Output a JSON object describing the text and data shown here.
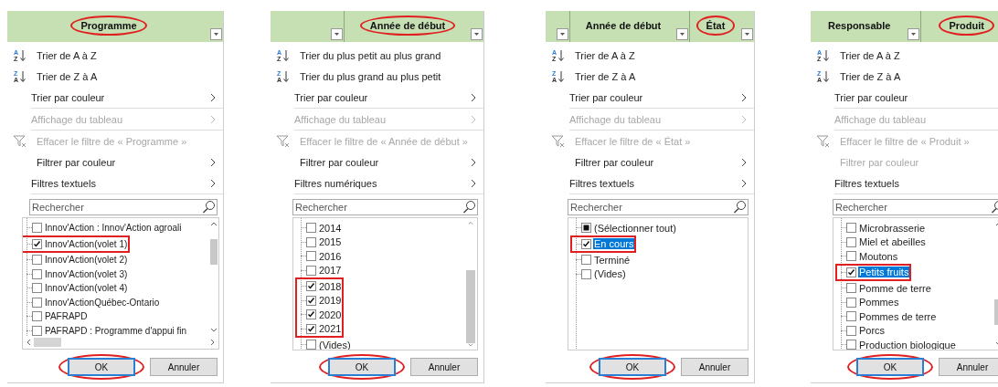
{
  "panels": [
    {
      "header_columns": [
        {
          "label": "Programme",
          "dropdown": true,
          "circled": true
        }
      ],
      "menu": [
        {
          "kind": "sort",
          "icon_top": "A",
          "icon_bottom": "Z",
          "label": "Trier de A à Z",
          "disabled": false,
          "submenu": false,
          "divider_below": false
        },
        {
          "kind": "sort",
          "icon_top": "Z",
          "icon_bottom": "A",
          "label": "Trier de Z à A",
          "disabled": false,
          "submenu": false,
          "divider_below": false
        },
        {
          "kind": "item",
          "label": "Trier par couleur",
          "disabled": false,
          "submenu": true,
          "divider_below": true
        },
        {
          "kind": "item",
          "label": "Affichage du tableau",
          "disabled": true,
          "submenu": true,
          "divider_below": true
        },
        {
          "kind": "clear",
          "label": "Effacer le filtre de « Programme »",
          "disabled": true,
          "submenu": false,
          "divider_below": false
        },
        {
          "kind": "item",
          "label": "Filtrer par couleur",
          "disabled": false,
          "submenu": true,
          "divider_below": false
        },
        {
          "kind": "item",
          "label": "Filtres textuels",
          "disabled": false,
          "submenu": true,
          "divider_below": true
        }
      ],
      "search": {
        "placeholder": "Rechercher"
      },
      "list": [
        {
          "label": "Innov'Action : Innov'Action agroali",
          "checked": false,
          "mixed": false,
          "selected": false,
          "boxed": false
        },
        {
          "label": "Innov'Action(volet 1)",
          "checked": true,
          "mixed": false,
          "selected": false,
          "boxed": true
        },
        {
          "label": "Innov'Action(volet 2)",
          "checked": false,
          "mixed": false,
          "selected": false,
          "boxed": false
        },
        {
          "label": "Innov'Action(volet 3)",
          "checked": false,
          "mixed": false,
          "selected": false,
          "boxed": false
        },
        {
          "label": "Innov'Action(volet 4)",
          "checked": false,
          "mixed": false,
          "selected": false,
          "boxed": false
        },
        {
          "label": "Innov'ActionQuébec-Ontario",
          "checked": false,
          "mixed": false,
          "selected": false,
          "boxed": false
        },
        {
          "label": "PAFRAPD",
          "checked": false,
          "mixed": false,
          "selected": false,
          "boxed": false
        },
        {
          "label": "PAFRAPD : Programme d'appui fin",
          "checked": false,
          "mixed": false,
          "selected": false,
          "boxed": false
        }
      ],
      "scrollbars": {
        "vertical": true,
        "horizontal": true
      },
      "buttons": [
        {
          "label": "OK",
          "kind": "default",
          "circled": true
        },
        {
          "label": "Annuler",
          "kind": "normal",
          "circled": false
        }
      ]
    },
    {
      "header_columns": [
        {
          "dropdown": true,
          "circled": false
        },
        {
          "label": "Année de début",
          "dropdown": true,
          "circled": true
        }
      ],
      "menu": [
        {
          "kind": "sort",
          "icon_top": "A",
          "icon_bottom": "Z",
          "label": "Trier du plus petit au plus grand",
          "disabled": false,
          "submenu": false,
          "divider_below": false
        },
        {
          "kind": "sort",
          "icon_top": "Z",
          "icon_bottom": "A",
          "label": "Trier du plus grand au plus petit",
          "disabled": false,
          "submenu": false,
          "divider_below": false
        },
        {
          "kind": "item",
          "label": "Trier par couleur",
          "disabled": false,
          "submenu": true,
          "divider_below": true
        },
        {
          "kind": "item",
          "label": "Affichage du tableau",
          "disabled": true,
          "submenu": true,
          "divider_below": true
        },
        {
          "kind": "clear",
          "label": "Effacer le filtre de « Année de début »",
          "disabled": true,
          "submenu": false,
          "divider_below": false
        },
        {
          "kind": "item",
          "label": "Filtrer par couleur",
          "disabled": false,
          "submenu": true,
          "divider_below": false
        },
        {
          "kind": "item",
          "label": "Filtres numériques",
          "disabled": false,
          "submenu": true,
          "divider_below": true
        }
      ],
      "search": {
        "placeholder": "Rechercher"
      },
      "list": [
        {
          "label": "2014",
          "checked": false,
          "mixed": false,
          "selected": false,
          "boxed": false
        },
        {
          "label": "2015",
          "checked": false,
          "mixed": false,
          "selected": false,
          "boxed": false
        },
        {
          "label": "2016",
          "checked": false,
          "mixed": false,
          "selected": false,
          "boxed": false
        },
        {
          "label": "2017",
          "checked": false,
          "mixed": false,
          "selected": false,
          "boxed": false
        },
        {
          "label": "2018",
          "checked": true,
          "mixed": false,
          "selected": false,
          "boxed": true
        },
        {
          "label": "2019",
          "checked": true,
          "mixed": false,
          "selected": false,
          "boxed": true
        },
        {
          "label": "2020",
          "checked": true,
          "mixed": false,
          "selected": false,
          "boxed": true
        },
        {
          "label": "2021",
          "checked": true,
          "mixed": false,
          "selected": false,
          "boxed": true
        },
        {
          "label": "(Vides)",
          "checked": false,
          "mixed": false,
          "selected": false,
          "boxed": false
        }
      ],
      "scrollbars": {
        "vertical": true,
        "horizontal": false
      },
      "buttons": [
        {
          "label": "OK",
          "kind": "default",
          "circled": true
        },
        {
          "label": "Annuler",
          "kind": "normal",
          "circled": false
        }
      ]
    },
    {
      "header_columns": [
        {
          "dropdown": true,
          "circled": false
        },
        {
          "label": "Année de début",
          "dropdown": true,
          "circled": false
        },
        {
          "label": "État",
          "dropdown": true,
          "circled": true
        }
      ],
      "menu": [
        {
          "kind": "sort",
          "icon_top": "A",
          "icon_bottom": "Z",
          "label": "Trier de A à Z",
          "disabled": false,
          "submenu": false,
          "divider_below": false
        },
        {
          "kind": "sort",
          "icon_top": "Z",
          "icon_bottom": "A",
          "label": "Trier de Z à A",
          "disabled": false,
          "submenu": false,
          "divider_below": false
        },
        {
          "kind": "item",
          "label": "Trier par couleur",
          "disabled": false,
          "submenu": true,
          "divider_below": true
        },
        {
          "kind": "item",
          "label": "Affichage du tableau",
          "disabled": true,
          "submenu": true,
          "divider_below": true
        },
        {
          "kind": "clear",
          "label": "Effacer le filtre de « État »",
          "disabled": true,
          "submenu": false,
          "divider_below": false
        },
        {
          "kind": "item",
          "label": "Filtrer par couleur",
          "disabled": false,
          "submenu": true,
          "divider_below": false
        },
        {
          "kind": "item",
          "label": "Filtres textuels",
          "disabled": false,
          "submenu": true,
          "divider_below": true
        }
      ],
      "search": {
        "placeholder": "Rechercher"
      },
      "list": [
        {
          "label": "(Sélectionner tout)",
          "checked": false,
          "mixed": true,
          "selected": false,
          "boxed": false
        },
        {
          "label": "En cours",
          "checked": true,
          "mixed": false,
          "selected": true,
          "boxed": true
        },
        {
          "label": "Terminé",
          "checked": false,
          "mixed": false,
          "selected": false,
          "boxed": false
        },
        {
          "label": "(Vides)",
          "checked": false,
          "mixed": false,
          "selected": false,
          "boxed": false
        }
      ],
      "scrollbars": {
        "vertical": false,
        "horizontal": false
      },
      "buttons": [
        {
          "label": "OK",
          "kind": "default",
          "circled": true
        },
        {
          "label": "Annuler",
          "kind": "normal",
          "circled": false
        }
      ]
    },
    {
      "header_columns": [
        {
          "label": "Responsable",
          "dropdown": true,
          "circled": false
        },
        {
          "label": "Produit",
          "dropdown": false,
          "circled": true
        }
      ],
      "menu": [
        {
          "kind": "sort",
          "icon_top": "A",
          "icon_bottom": "Z",
          "label": "Trier de A à Z",
          "disabled": false,
          "submenu": false,
          "divider_below": false
        },
        {
          "kind": "sort",
          "icon_top": "Z",
          "icon_bottom": "A",
          "label": "Trier de Z à A",
          "disabled": false,
          "submenu": false,
          "divider_below": false
        },
        {
          "kind": "item",
          "label": "Trier par couleur",
          "disabled": false,
          "submenu": false,
          "divider_below": true
        },
        {
          "kind": "item",
          "label": "Affichage du tableau",
          "disabled": true,
          "submenu": false,
          "divider_below": true
        },
        {
          "kind": "clear",
          "label": "Effacer le filtre de « Produit »",
          "disabled": true,
          "submenu": false,
          "divider_below": false
        },
        {
          "kind": "item",
          "label": "Filtrer par couleur",
          "disabled": true,
          "submenu": false,
          "divider_below": false
        },
        {
          "kind": "item",
          "label": "Filtres textuels",
          "disabled": false,
          "submenu": false,
          "divider_below": true
        }
      ],
      "search": {
        "placeholder": "Rechercher"
      },
      "list": [
        {
          "label": "Microbrasserie",
          "checked": false,
          "mixed": false,
          "selected": false,
          "boxed": false
        },
        {
          "label": "Miel et abeilles",
          "checked": false,
          "mixed": false,
          "selected": false,
          "boxed": false
        },
        {
          "label": "Moutons",
          "checked": false,
          "mixed": false,
          "selected": false,
          "boxed": false
        },
        {
          "label": "Petits fruits",
          "checked": true,
          "mixed": false,
          "selected": true,
          "boxed": true
        },
        {
          "label": "Pomme de terre",
          "checked": false,
          "mixed": false,
          "selected": false,
          "boxed": false
        },
        {
          "label": "Pommes",
          "checked": false,
          "mixed": false,
          "selected": false,
          "boxed": false
        },
        {
          "label": "Pommes de terre",
          "checked": false,
          "mixed": false,
          "selected": false,
          "boxed": false
        },
        {
          "label": "Porcs",
          "checked": false,
          "mixed": false,
          "selected": false,
          "boxed": false
        },
        {
          "label": "Production biologique",
          "checked": false,
          "mixed": false,
          "selected": false,
          "boxed": false
        }
      ],
      "scrollbars": {
        "vertical": true,
        "horizontal": false
      },
      "buttons": [
        {
          "label": "OK",
          "kind": "default",
          "circled": true
        },
        {
          "label": "Annuler",
          "kind": "normal",
          "circled": false
        }
      ]
    }
  ]
}
